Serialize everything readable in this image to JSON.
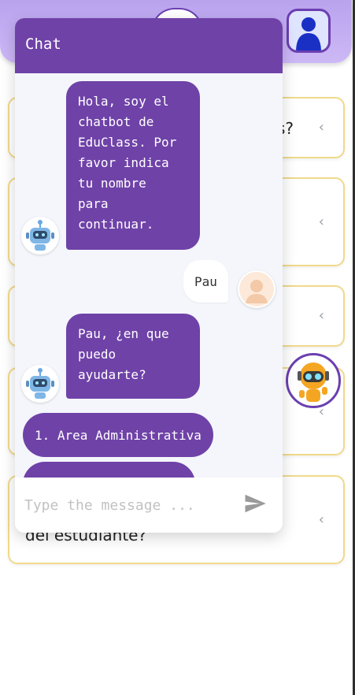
{
  "chat": {
    "title": "Chat",
    "messages": [
      {
        "from": "bot",
        "text": "Hola, soy el\nchatbot de\nEduClass. Por\nfavor indica\ntu nombre\npara\ncontinuar."
      },
      {
        "from": "user",
        "text": "Pau"
      },
      {
        "from": "bot",
        "text": "Pau, ¿en que\npuedo\nayudarte?"
      }
    ],
    "options": [
      "1. Area Administrativa"
    ],
    "input_placeholder": "Type the message ..."
  },
  "background": {
    "cards": [
      {
        "text": "s?"
      },
      {
        "text": ""
      },
      {
        "text": ""
      },
      {
        "text": ""
      },
      {
        "text": "del estudiante?"
      }
    ]
  },
  "colors": {
    "primary": "#6f42a8",
    "header_gradient": "#b9a3ee",
    "card_border": "#f0d98a"
  }
}
